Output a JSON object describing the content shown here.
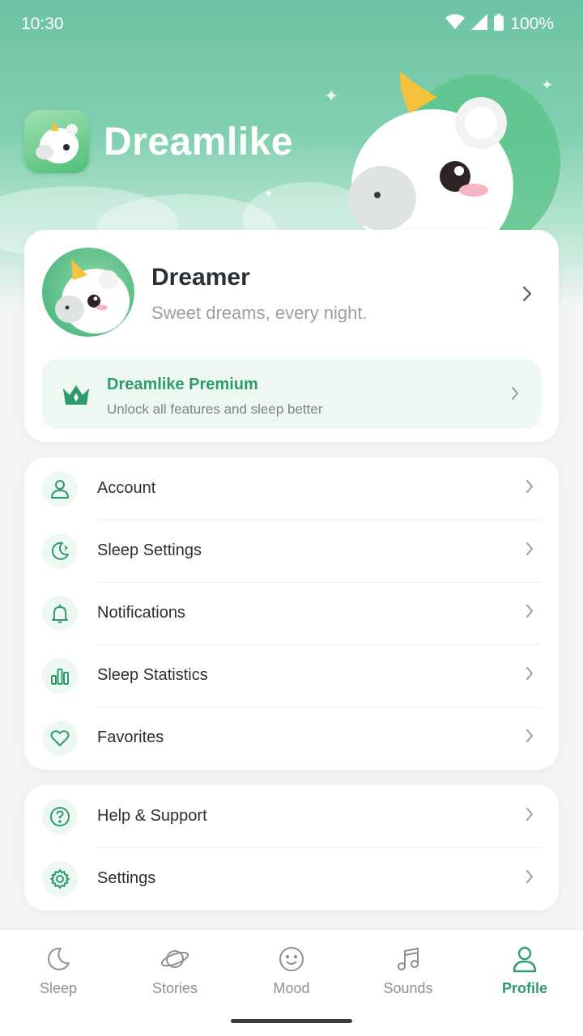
{
  "status": {
    "time": "10:30",
    "battery": "100%"
  },
  "brand": {
    "name": "Dreamlike"
  },
  "profile": {
    "name": "Dreamer",
    "tagline": "Sweet dreams, every night."
  },
  "premium": {
    "title": "Dreamlike Premium",
    "subtitle": "Unlock all features and sleep better"
  },
  "menu_primary": [
    {
      "label": "Account",
      "icon": "user-icon"
    },
    {
      "label": "Sleep Settings",
      "icon": "moon-icon"
    },
    {
      "label": "Notifications",
      "icon": "bell-icon"
    },
    {
      "label": "Sleep Statistics",
      "icon": "bar-chart-icon"
    },
    {
      "label": "Favorites",
      "icon": "heart-icon"
    }
  ],
  "menu_secondary": [
    {
      "label": "Help & Support",
      "icon": "help-icon"
    },
    {
      "label": "Settings",
      "icon": "gear-icon"
    }
  ],
  "tabs": [
    {
      "label": "Sleep",
      "icon": "moon-icon"
    },
    {
      "label": "Stories",
      "icon": "planet-icon"
    },
    {
      "label": "Mood",
      "icon": "smile-icon"
    },
    {
      "label": "Sounds",
      "icon": "music-icon"
    },
    {
      "label": "Profile",
      "icon": "user-icon",
      "active": true
    }
  ],
  "colors": {
    "accent": "#2f9a6a",
    "header": "#6cc3a3",
    "tint": "#eef8f2"
  }
}
